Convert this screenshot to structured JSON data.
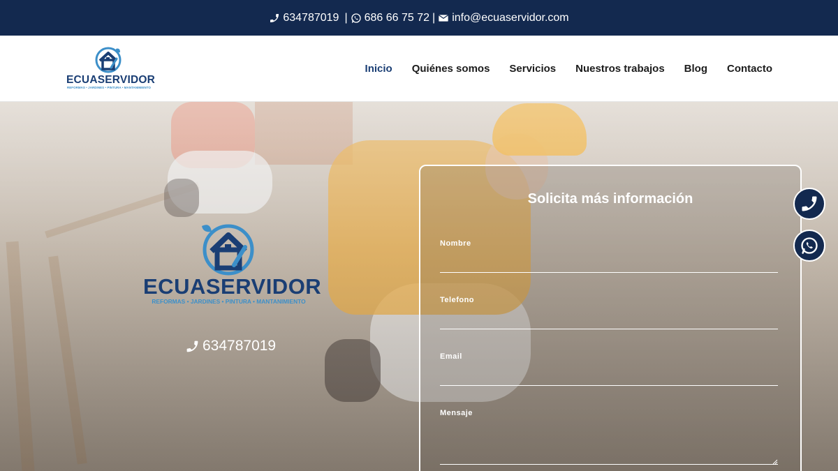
{
  "topbar": {
    "phone": "634787019",
    "whatsapp": "686 66 75 72",
    "email": "info@ecuaservidor.com",
    "separator": "|",
    "icons": [
      "phone-icon",
      "whatsapp-icon",
      "envelope-icon"
    ]
  },
  "brand": {
    "name": "ECUASERVIDOR",
    "tagline": "REFORMAS • JARDINES • PINTURA • MANTANIMIENTO",
    "colors": {
      "navy": "#13294f",
      "logo_text": "#1a3e74",
      "accent": "#3c8fc9"
    }
  },
  "nav": {
    "items": [
      {
        "label": "Inicio",
        "active": true
      },
      {
        "label": "Quiénes somos",
        "active": false
      },
      {
        "label": "Servicios",
        "active": false
      },
      {
        "label": "Nuestros trabajos",
        "active": false
      },
      {
        "label": "Blog",
        "active": false
      },
      {
        "label": "Contacto",
        "active": false
      }
    ]
  },
  "hero": {
    "phone": "634787019"
  },
  "form": {
    "title": "Solicita más información",
    "fields": [
      {
        "label": "Nombre",
        "value": ""
      },
      {
        "label": "Telefono",
        "value": ""
      },
      {
        "label": "Email",
        "value": ""
      },
      {
        "label": "Mensaje",
        "value": ""
      }
    ]
  },
  "floating": {
    "buttons": [
      "phone-icon",
      "whatsapp-icon"
    ]
  }
}
